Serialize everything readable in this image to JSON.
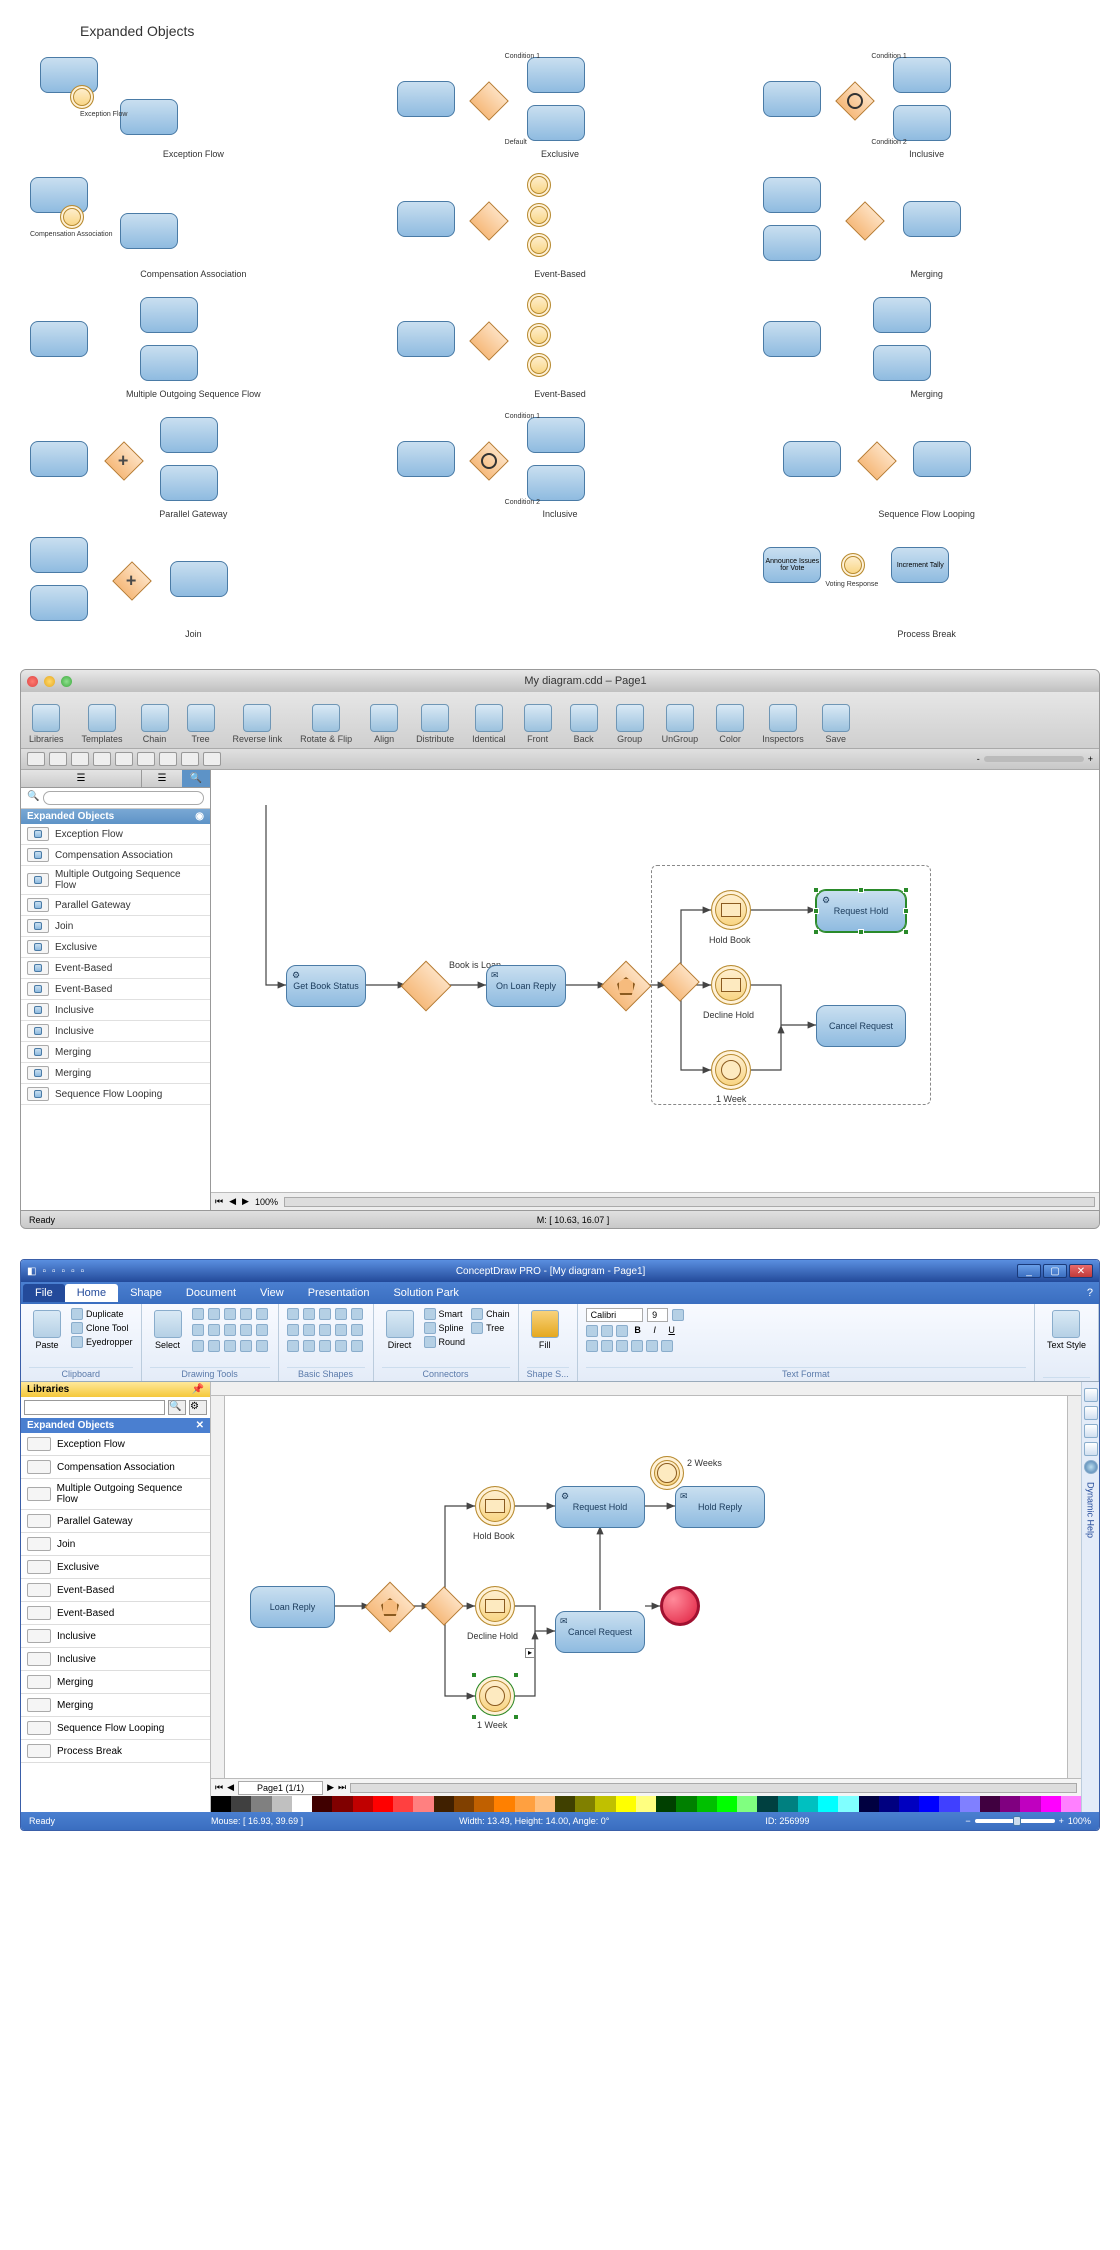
{
  "top": {
    "title": "Expanded Objects",
    "items": [
      {
        "label": "Exception Flow",
        "sublabels": [
          "Exception Flow"
        ]
      },
      {
        "label": "Exclusive",
        "sublabels": [
          "Condition 1",
          "Default"
        ]
      },
      {
        "label": "Inclusive",
        "sublabels": [
          "Condition 1",
          "Condition 2"
        ]
      },
      {
        "label": "Compensation Association",
        "sublabels": [
          "Compensation Association"
        ]
      },
      {
        "label": "Event-Based",
        "sublabels": []
      },
      {
        "label": "Merging",
        "sublabels": []
      },
      {
        "label": "Multiple Outgoing Sequence Flow",
        "sublabels": []
      },
      {
        "label": "Event-Based",
        "sublabels": []
      },
      {
        "label": "Merging",
        "sublabels": []
      },
      {
        "label": "Parallel Gateway",
        "sublabels": []
      },
      {
        "label": "Inclusive",
        "sublabels": [
          "Condition 1",
          "Condition 2"
        ]
      },
      {
        "label": "Sequence Flow Looping",
        "sublabels": []
      },
      {
        "label": "Join",
        "sublabels": []
      },
      {
        "label": "",
        "sublabels": []
      },
      {
        "label": "Process Break",
        "sublabels": [
          "Announce Issues for Vote",
          "Voting Response",
          "Increment Tally"
        ]
      }
    ]
  },
  "mac": {
    "title": "My diagram.cdd – Page1",
    "toolbar": [
      "Libraries",
      "Templates",
      "Chain",
      "Tree",
      "Reverse link",
      "Rotate & Flip",
      "Align",
      "Distribute",
      "Identical",
      "Front",
      "Back",
      "Group",
      "UnGroup",
      "Color",
      "Inspectors",
      "Save"
    ],
    "side_header": "Expanded Objects",
    "side_items": [
      "Exception Flow",
      "Compensation Association",
      "Multiple Outgoing Sequence Flow",
      "Parallel Gateway",
      "Join",
      "Exclusive",
      "Event-Based",
      "Event-Based",
      "Inclusive",
      "Inclusive",
      "Merging",
      "Merging",
      "Sequence Flow Looping"
    ],
    "canvas": {
      "tasks": {
        "get_book": "Get Book Status",
        "on_loan": "On Loan Reply",
        "request_hold": "Request Hold",
        "cancel_request": "Cancel Request"
      },
      "flow_labels": {
        "book_is_loan": "Book is Loan",
        "hold_book": "Hold Book",
        "decline_hold": "Decline Hold",
        "one_week": "1 Week"
      }
    },
    "status": {
      "ready": "Ready",
      "zoom": "100%",
      "mouse": "M: [ 10.63, 16.07 ]"
    }
  },
  "win": {
    "title": "ConceptDraw PRO - [My diagram - Page1]",
    "file_tab": "File",
    "tabs": [
      "Home",
      "Shape",
      "Document",
      "View",
      "Presentation",
      "Solution Park"
    ],
    "ribbon": {
      "clipboard": {
        "label": "Clipboard",
        "items": [
          "Duplicate",
          "Clone Tool",
          "Eyedropper"
        ]
      },
      "drawing": {
        "label": "Drawing Tools",
        "big": "Select"
      },
      "shapes": {
        "label": "Basic Shapes"
      },
      "connectors": {
        "label": "Connectors",
        "big": "Direct",
        "items": [
          "Smart",
          "Spline",
          "Round"
        ],
        "items2": [
          "Chain",
          "Tree"
        ]
      },
      "fill": {
        "label": "Shape S...",
        "big": "Fill"
      },
      "text": {
        "label": "Text Format",
        "font": "Calibri",
        "size": "9"
      },
      "textstyle": {
        "label": "",
        "big": "Text Style"
      }
    },
    "libraries_title": "Libraries",
    "side_header": "Expanded Objects",
    "side_items": [
      "Exception Flow",
      "Compensation Association",
      "Multiple Outgoing Sequence Flow",
      "Parallel Gateway",
      "Join",
      "Exclusive",
      "Event-Based",
      "Event-Based",
      "Inclusive",
      "Inclusive",
      "Merging",
      "Merging",
      "Sequence Flow Looping",
      "Process Break"
    ],
    "canvas": {
      "tasks": {
        "loan_reply": "Loan Reply",
        "request_hold": "Request Hold",
        "cancel_request": "Cancel Request",
        "hold_reply": "Hold Reply"
      },
      "flow_labels": {
        "hold_book": "Hold Book",
        "decline_hold": "Decline Hold",
        "one_week": "1 Week",
        "two_weeks": "2 Weeks"
      }
    },
    "right_tab": "Dynamic Help",
    "page_tab": "Page1 (1/1)",
    "status": {
      "ready": "Ready",
      "mouse": "Mouse: [ 16.93, 39.69 ]",
      "dims": "Width: 13.49,   Height: 14.00,   Angle: 0°",
      "id": "ID: 256999",
      "zoom": "100%"
    },
    "palette": [
      "#000000",
      "#404040",
      "#808080",
      "#c0c0c0",
      "#ffffff",
      "#400000",
      "#800000",
      "#c00000",
      "#ff0000",
      "#ff4040",
      "#ff8080",
      "#402000",
      "#804000",
      "#c06000",
      "#ff8000",
      "#ffa040",
      "#ffc080",
      "#404000",
      "#808000",
      "#c0c000",
      "#ffff00",
      "#ffff80",
      "#004000",
      "#008000",
      "#00c000",
      "#00ff00",
      "#80ff80",
      "#004040",
      "#008080",
      "#00c0c0",
      "#00ffff",
      "#80ffff",
      "#000040",
      "#000080",
      "#0000c0",
      "#0000ff",
      "#4040ff",
      "#8080ff",
      "#400040",
      "#800080",
      "#c000c0",
      "#ff00ff",
      "#ff80ff"
    ]
  }
}
